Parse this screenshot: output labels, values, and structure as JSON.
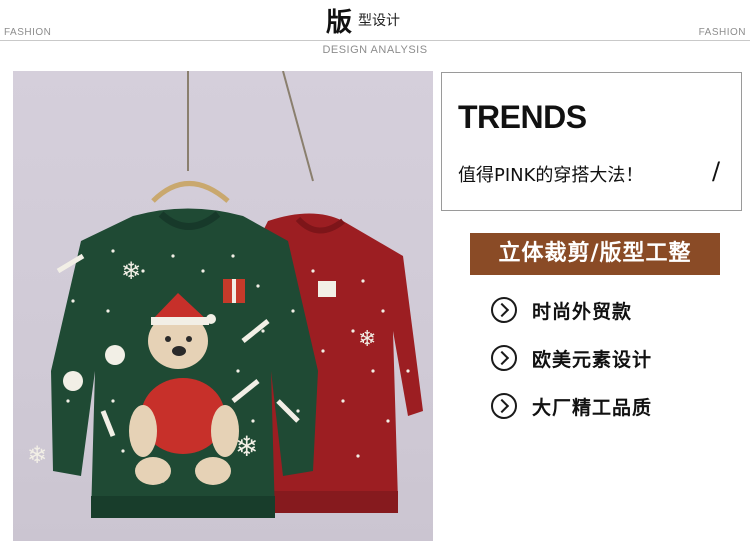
{
  "header": {
    "title_big": "版",
    "title_small": "型设计",
    "fashion_left": "FASHION",
    "fashion_right": "FASHION",
    "subtitle": "DESIGN ANALYSIS"
  },
  "trends": {
    "title": "TRENDS",
    "subtitle": "值得PINK的穿搭大法！",
    "slash": "/"
  },
  "banner": {
    "text": "立体裁剪/版型工整"
  },
  "features": [
    {
      "label": "时尚外贸款",
      "icon": "chevron-right-circle-icon"
    },
    {
      "label": "欧美元素设计",
      "icon": "chevron-right-circle-icon"
    },
    {
      "label": "大厂精工品质",
      "icon": "chevron-right-circle-icon"
    }
  ],
  "photo": {
    "description_icon": "christmas-sweater-photo",
    "colors": {
      "green": "#1f4a34",
      "red": "#9c1e22",
      "background": "#d3cdd9",
      "banner": "#8a4b26"
    }
  }
}
